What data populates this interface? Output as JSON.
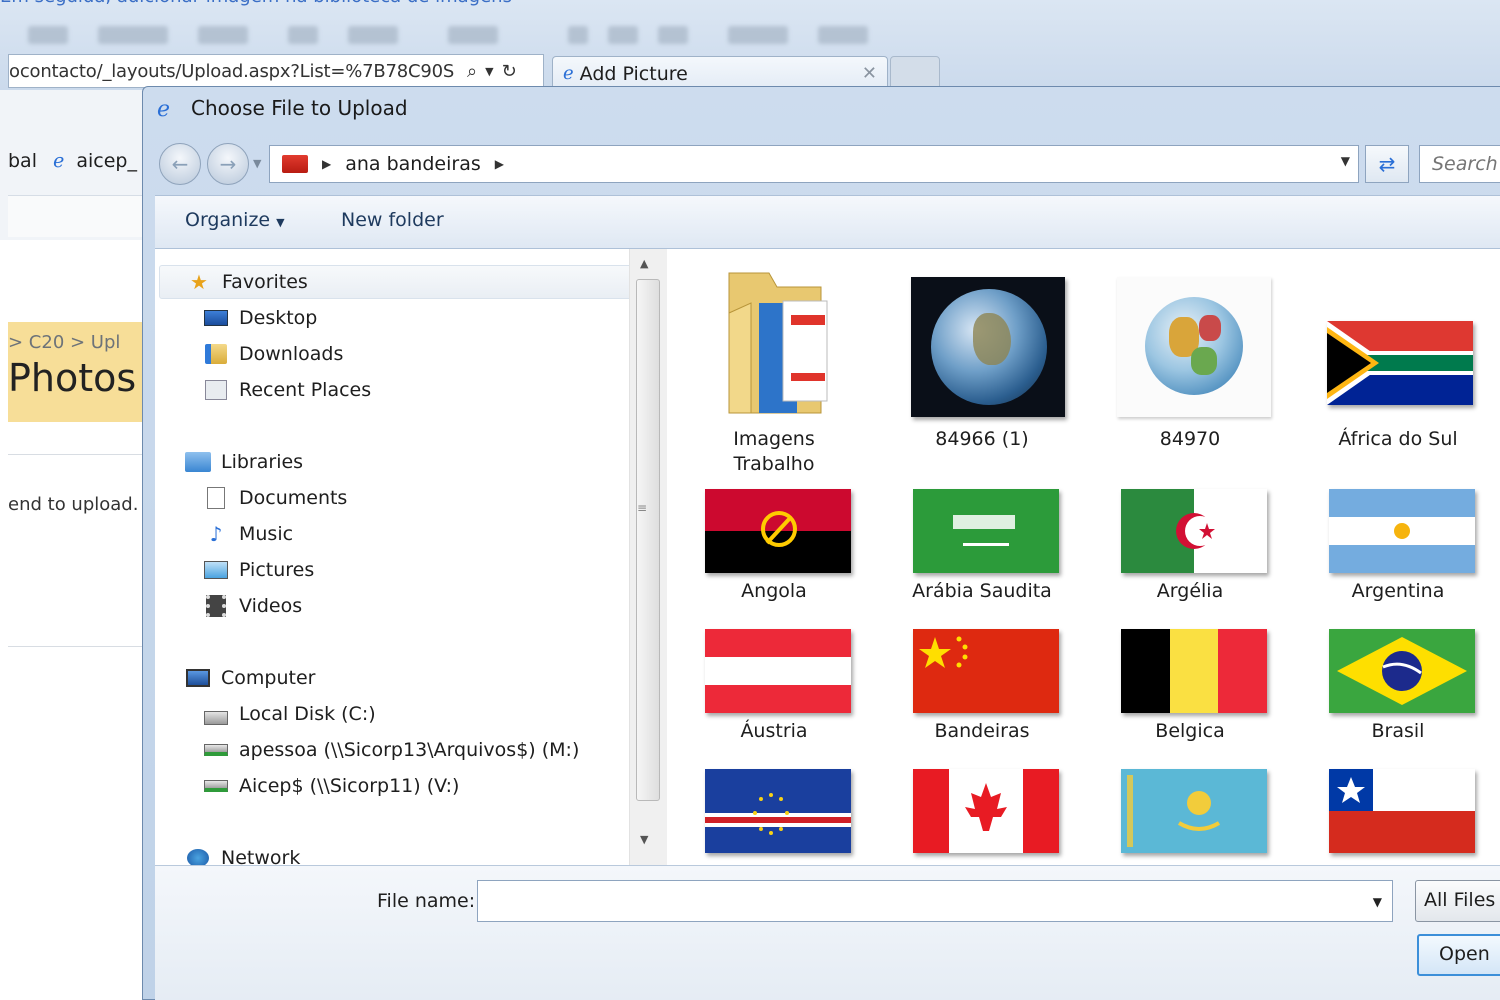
{
  "browser": {
    "top_link": "Em seguida, adicionar imagem na biblioteca de imagens",
    "address_url": "ocontacto/_layouts/Upload.aspx?List=%7B78C90S",
    "tab_title": "Add Picture",
    "favorites_text": "bal",
    "favorites_link": "aicep_",
    "breadcrumb": "> C20 > Upl",
    "page_title": "Photos",
    "upload_text": "end to upload."
  },
  "dialog": {
    "title": "Choose File to Upload",
    "path": "ana bandeiras",
    "search_placeholder": "Search",
    "toolbar": {
      "organize_label": "Organize",
      "new_folder_label": "New folder"
    },
    "nav": {
      "favorites": {
        "label": "Favorites",
        "icon": "star-icon",
        "items": [
          {
            "label": "Desktop",
            "icon": "desktop-icon"
          },
          {
            "label": "Downloads",
            "icon": "downloads-icon"
          },
          {
            "label": "Recent Places",
            "icon": "recent-places-icon"
          }
        ]
      },
      "libraries": {
        "label": "Libraries",
        "icon": "libraries-icon",
        "items": [
          {
            "label": "Documents",
            "icon": "documents-icon"
          },
          {
            "label": "Music",
            "icon": "music-icon"
          },
          {
            "label": "Pictures",
            "icon": "pictures-icon"
          },
          {
            "label": "Videos",
            "icon": "videos-icon"
          }
        ]
      },
      "computer": {
        "label": "Computer",
        "icon": "computer-icon",
        "items": [
          {
            "label": "Local Disk (C:)",
            "icon": "local-disk-icon"
          },
          {
            "label": "apessoa (\\\\Sicorp13\\Arquivos$) (M:)",
            "icon": "network-drive-icon"
          },
          {
            "label": "Aicep$ (\\\\Sicorp11) (V:)",
            "icon": "network-drive-icon"
          }
        ]
      },
      "network": {
        "label": "Network",
        "icon": "network-icon"
      }
    },
    "files": [
      {
        "label": "Imagens\nTrabalho",
        "kind": "folder"
      },
      {
        "label": "84966 (1)",
        "kind": "earth"
      },
      {
        "label": "84970",
        "kind": "globe"
      },
      {
        "label": "África do Sul",
        "kind": "flag-south-africa"
      },
      {
        "label": "Angola",
        "kind": "flag-angola"
      },
      {
        "label": "Arábia Saudita",
        "kind": "flag-saudi-arabia"
      },
      {
        "label": "Argélia",
        "kind": "flag-algeria"
      },
      {
        "label": "Argentina",
        "kind": "flag-argentina"
      },
      {
        "label": "Áustria",
        "kind": "flag-austria"
      },
      {
        "label": "Bandeiras",
        "kind": "flag-china"
      },
      {
        "label": "Belgica",
        "kind": "flag-belgium"
      },
      {
        "label": "Brasil",
        "kind": "flag-brazil"
      },
      {
        "label": "",
        "kind": "flag-cape-verde"
      },
      {
        "label": "",
        "kind": "flag-canada"
      },
      {
        "label": "",
        "kind": "flag-kazakhstan"
      },
      {
        "label": "",
        "kind": "flag-chile"
      }
    ],
    "file_name_label": "File name:",
    "file_name_value": "",
    "file_type": "All Files (",
    "open_label": "Open"
  }
}
